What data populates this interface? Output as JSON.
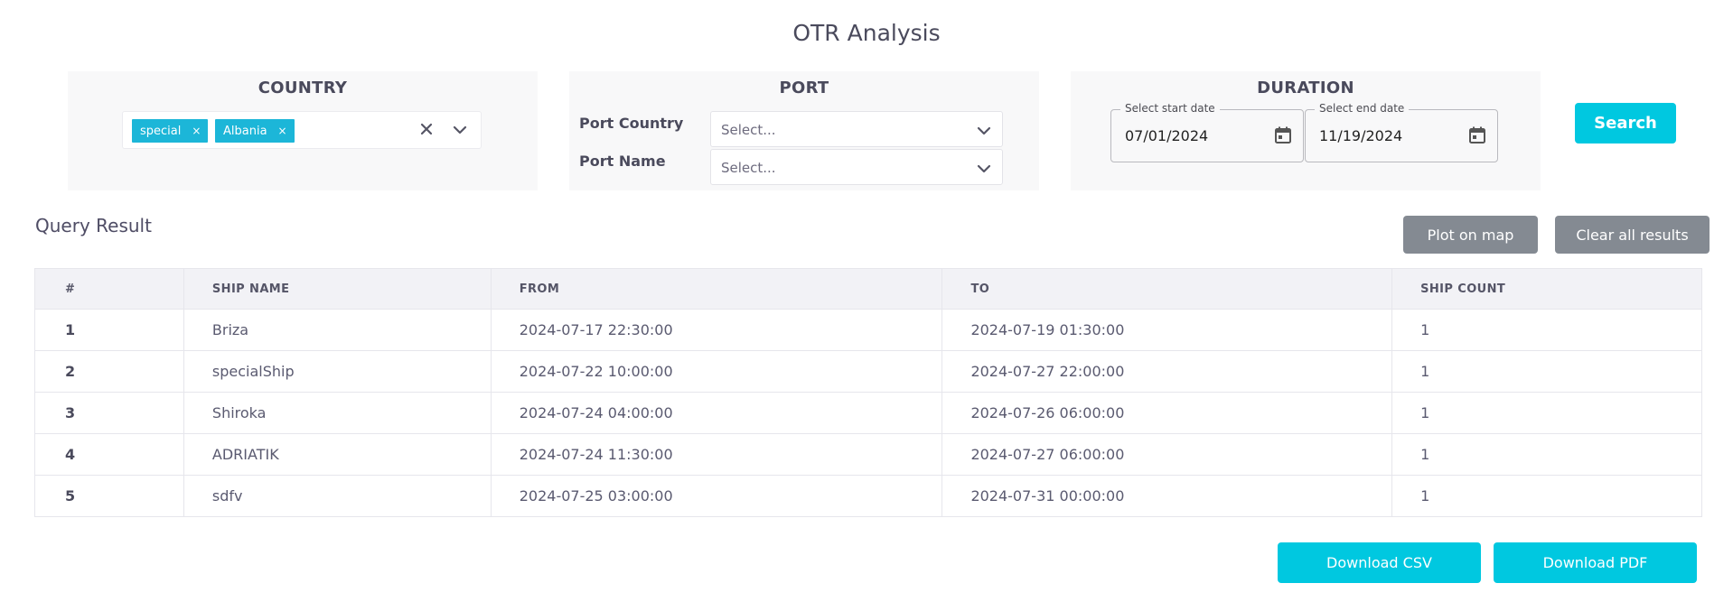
{
  "page": {
    "title": "OTR Analysis"
  },
  "country": {
    "title": "COUNTRY",
    "selected": [
      "special",
      "Albania"
    ],
    "chip_remove": "×"
  },
  "port": {
    "title": "PORT",
    "country_label": "Port Country",
    "country_placeholder": "Select...",
    "name_label": "Port Name",
    "name_placeholder": "Select..."
  },
  "duration": {
    "title": "DURATION",
    "start_label": "Select start date",
    "start_value": "07/01/2024",
    "end_label": "Select end date",
    "end_value": "11/19/2024"
  },
  "actions": {
    "search": "Search",
    "plot_on_map": "Plot on map",
    "clear_all": "Clear all results",
    "download_csv": "Download CSV",
    "download_pdf": "Download PDF"
  },
  "results": {
    "title": "Query Result",
    "columns": [
      "#",
      "SHIP NAME",
      "FROM",
      "TO",
      "SHIP COUNT"
    ],
    "rows": [
      [
        "1",
        "Briza",
        "2024-07-17 22:30:00",
        "2024-07-19 01:30:00",
        "1"
      ],
      [
        "2",
        "specialShip",
        "2024-07-22 10:00:00",
        "2024-07-27 22:00:00",
        "1"
      ],
      [
        "3",
        "Shiroka",
        "2024-07-24 04:00:00",
        "2024-07-26 06:00:00",
        "1"
      ],
      [
        "4",
        "ADRIATIK",
        "2024-07-24 11:30:00",
        "2024-07-27 06:00:00",
        "1"
      ],
      [
        "5",
        "sdfv",
        "2024-07-25 03:00:00",
        "2024-07-31 00:00:00",
        "1"
      ]
    ]
  },
  "colors": {
    "accent": "#00c8e0",
    "chip": "#1cb6d8",
    "secondary_button": "#848a92",
    "card_bg": "#f8f8f9"
  },
  "icons": {
    "clear": "close-icon",
    "dropdown": "chevron-down-icon",
    "date": "calendar-icon"
  }
}
